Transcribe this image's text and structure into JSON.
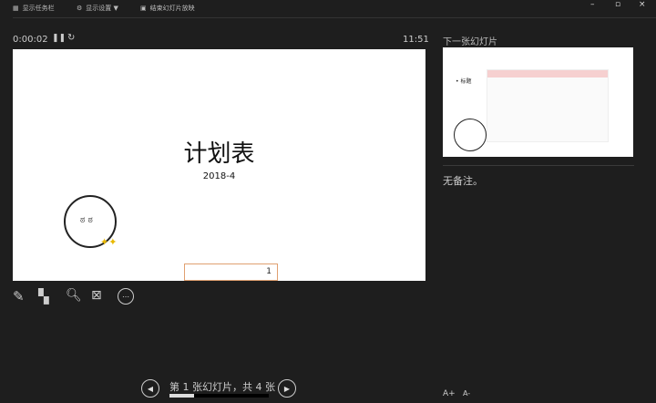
{
  "toolbar": {
    "show_taskbar": "显示任务栏",
    "display_settings": "显示设置 ▼",
    "end_show": "结束幻灯片放映"
  },
  "window": {
    "minimize": "–",
    "restore": "▫",
    "close": "×"
  },
  "timer": {
    "elapsed": "0:00:02",
    "clock": "11:51"
  },
  "slide": {
    "title": "计划表",
    "subtitle": "2018-4",
    "box_text": "1"
  },
  "next": {
    "label": "下一张幻灯片",
    "bullet": "• 标题"
  },
  "notes": {
    "text": "无备注。"
  },
  "nav": {
    "status": "第 1 张幻灯片，共 4 张",
    "progress": 0.25
  },
  "font": {
    "increase": "A+",
    "decrease": "A-"
  }
}
